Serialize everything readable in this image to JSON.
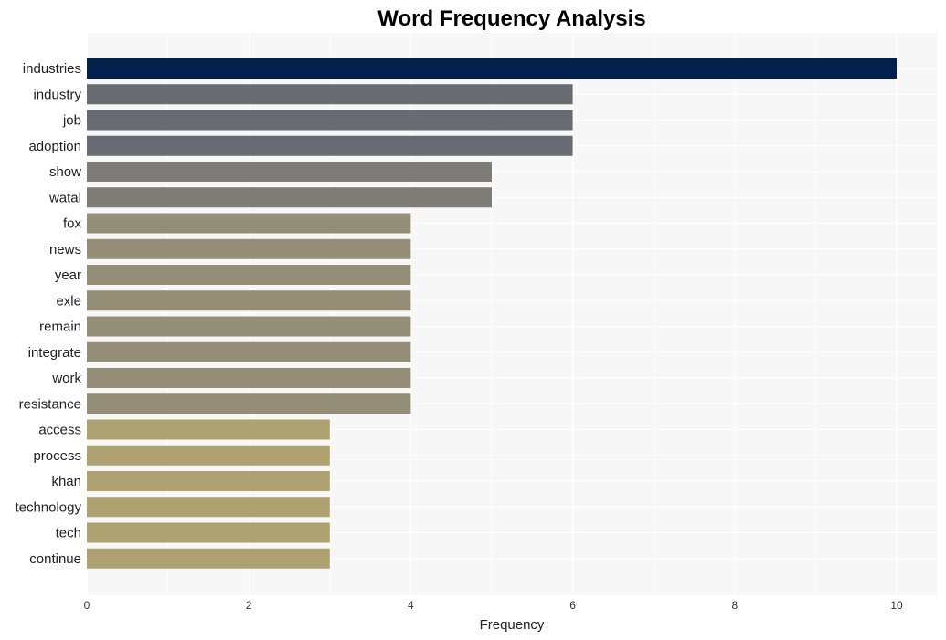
{
  "chart_data": {
    "type": "bar",
    "orientation": "horizontal",
    "title": "Word Frequency Analysis",
    "xlabel": "Frequency",
    "ylabel": "",
    "xlim": [
      0,
      10.5
    ],
    "xticks": [
      0,
      2,
      4,
      6,
      8,
      10
    ],
    "grid": true,
    "categories": [
      "industries",
      "industry",
      "job",
      "adoption",
      "show",
      "watal",
      "fox",
      "news",
      "year",
      "exle",
      "remain",
      "integrate",
      "work",
      "resistance",
      "access",
      "process",
      "khan",
      "technology",
      "tech",
      "continue"
    ],
    "values": [
      10,
      6,
      6,
      6,
      5,
      5,
      4,
      4,
      4,
      4,
      4,
      4,
      4,
      4,
      3,
      3,
      3,
      3,
      3,
      3
    ],
    "colors": {
      "10": "#00204e",
      "6": "#686b72",
      "5": "#7d7c77",
      "4": "#958e77",
      "3": "#aea270"
    },
    "background": "#f7f7f7"
  }
}
